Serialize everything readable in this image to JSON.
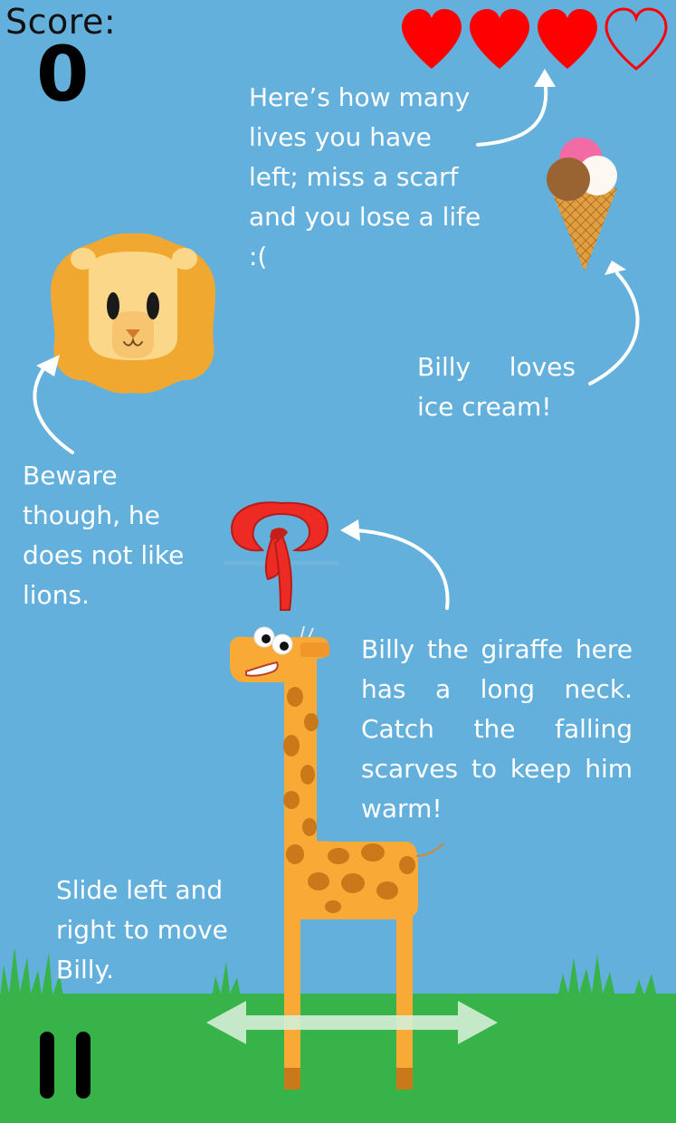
{
  "hud": {
    "score_label": "Score:",
    "score_value": "0",
    "lives_total": 4,
    "lives_remaining": 3
  },
  "tips": {
    "lives": "Here’s how many lives you have left; miss a scarf and you lose a life :(",
    "ice_cream": "Billy loves ice cream!",
    "lion": "Beware though, he does not like lions.",
    "giraffe": "Billy the giraffe here has a long neck. Catch the falling scarves to keep him warm!",
    "move": "Slide left and right to move Billy."
  },
  "icons": {
    "heart_full": "heart-full-icon",
    "heart_empty": "heart-empty-icon",
    "pause": "pause-icon",
    "ice_cream": "ice-cream-icon",
    "lion": "lion-face",
    "scarf": "scarf",
    "giraffe": "giraffe"
  },
  "colors": {
    "sky": "#64b0dd",
    "ground": "#37b34a",
    "heart": "#ff0000",
    "giraffe": "#f9a935",
    "scarf": "#ee2a24",
    "lion_mane": "#f0a830",
    "text": "#ffffff"
  }
}
